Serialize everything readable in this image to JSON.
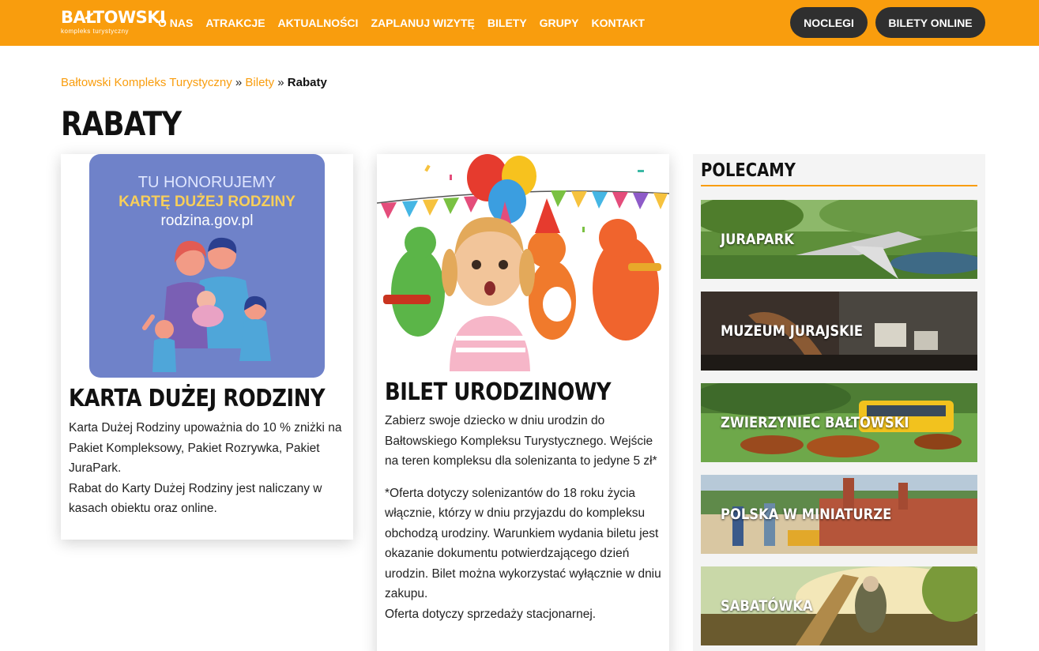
{
  "header": {
    "logo": {
      "name": "BAŁTOWSKI",
      "tagline": "kompleks turystyczny"
    },
    "nav": [
      "O NAS",
      "ATRAKCJE",
      "AKTUALNOŚCI",
      "ZAPLANUJ WIZYTĘ",
      "BILETY",
      "GRUPY",
      "KONTAKT"
    ],
    "noclegi_label": "NOCLEGI",
    "bilety_online_label": "BILETY ONLINE",
    "accent_color": "#f99d0d",
    "button_color": "#2f2f2f"
  },
  "breadcrumb": {
    "items": [
      "Bałtowski Kompleks Turystyczny",
      "Bilety"
    ],
    "separator": "»",
    "current": "Rabaty"
  },
  "page_title": "RABATY",
  "cards": [
    {
      "image": {
        "line1": "TU HONORUJEMY",
        "line2": "KARTĘ DUŻEJ RODZINY",
        "line3": "rodzina.gov.pl"
      },
      "title": "KARTA DUŻEJ RODZINY",
      "paragraphs": [
        "Karta Dużej Rodziny upoważnia do 10 % zniżki na Pakiet  Kompleksowy,  Pakiet Rozrywka, Pakiet JuraPark.",
        "Rabat do Karty Dużej Rodziny jest naliczany w kasach obiektu oraz online."
      ]
    },
    {
      "title": "BILET URODZINOWY",
      "paragraphs": [
        "Zabierz swoje dziecko w dniu urodzin do Bałtowskiego Kompleksu Turystycznego. Wejście na teren kompleksu dla solenizanta to jedyne 5 zł*",
        "*Oferta dotyczy solenizantów do 18 roku życia włącznie, którzy w dniu przyjazdu do kompleksu obchodzą urodziny. Warunkiem wydania biletu jest okazanie dokumentu potwierdzającego dzień urodzin. Bilet można wykorzystać wyłącznie w dniu zakupu.",
        "Oferta dotyczy sprzedaży stacjonarnej."
      ]
    }
  ],
  "sidebar": {
    "title": "POLECAMY",
    "tiles": [
      "JURAPARK",
      "MUZEUM JURAJSKIE",
      "ZWIERZYNIEC BAŁTOWSKI",
      "POLSKA W MINIATURZE",
      "SABATÓWKA"
    ]
  }
}
